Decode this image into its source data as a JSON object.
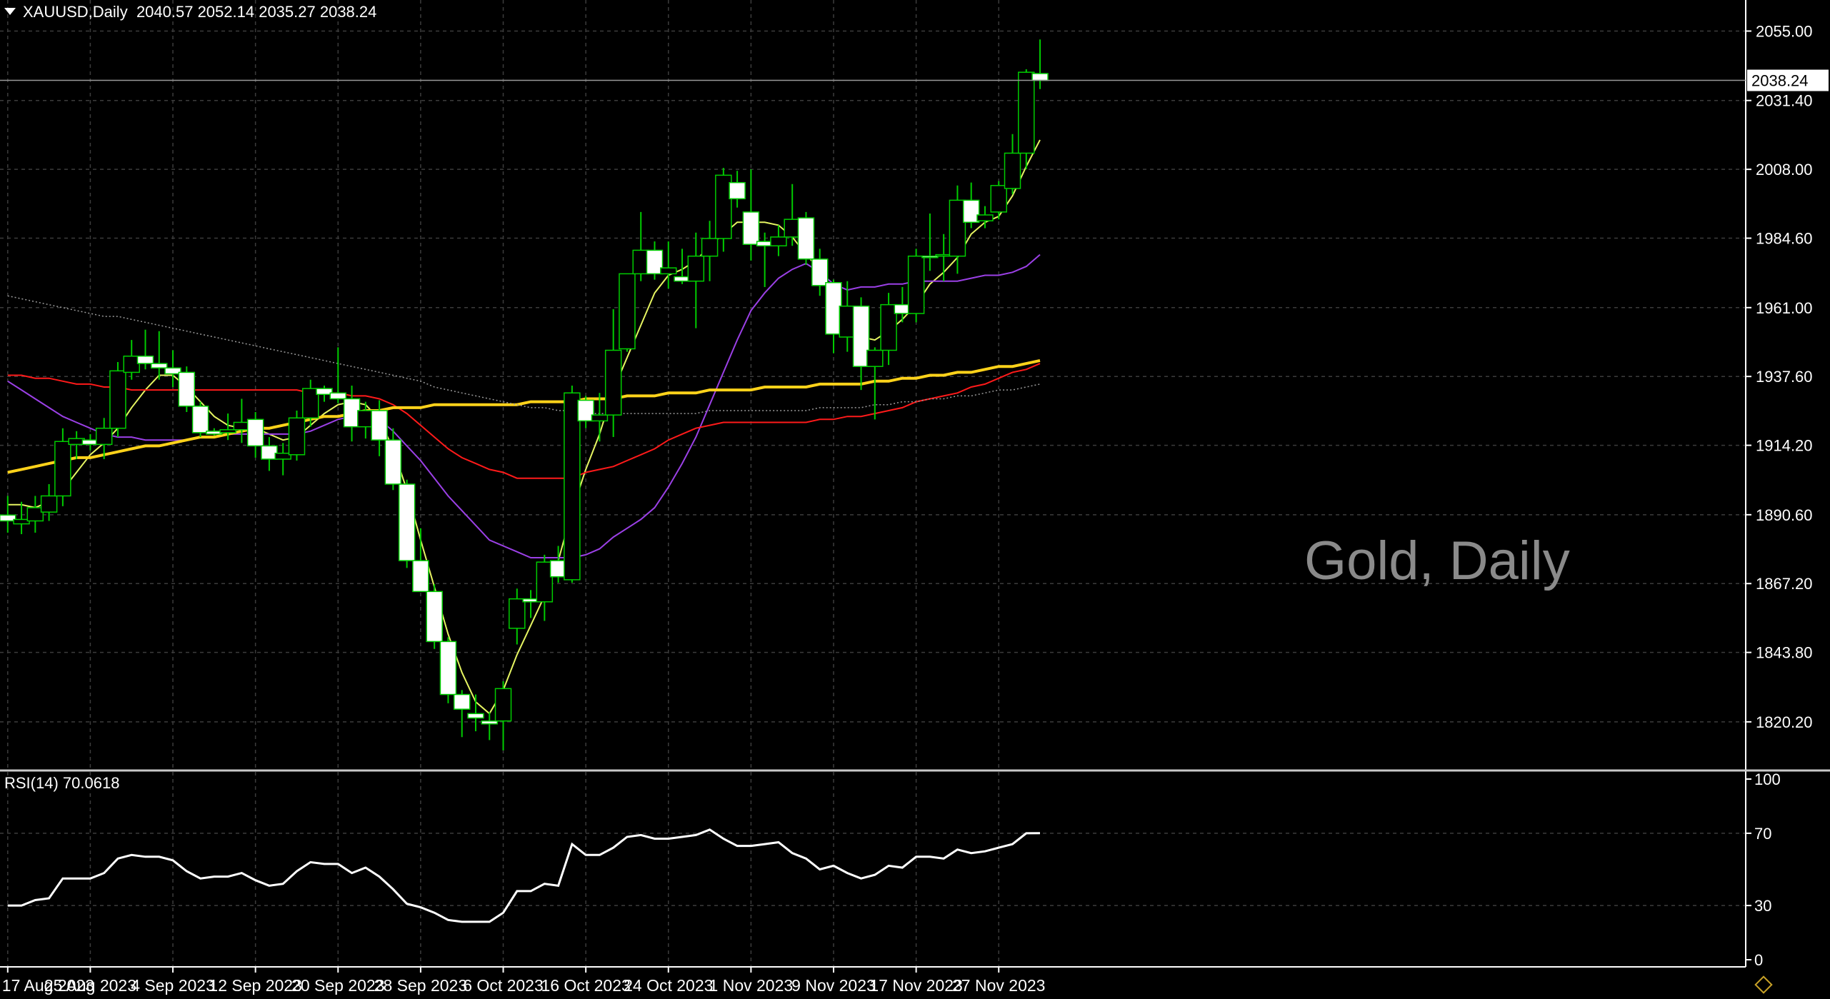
{
  "header": {
    "symbol": "XAUUSD,Daily",
    "ohlc": "2040.57 2052.14 2035.27 2038.24"
  },
  "watermark": "Gold, Daily",
  "rsi_label": "RSI(14) 70.0618",
  "last_price_label": "2038.24",
  "colors": {
    "background": "#000000",
    "grid": "#3c3c3c",
    "bull_candle_outline": "#00cc00",
    "bear_candle_fill": "#ffffff",
    "ma_fast": "#e6f562",
    "ma_mid": "#9b40e6",
    "ma_slow": "#ff1a1a",
    "ma_long": "#ffd21a",
    "ma_200_dotted": "#9a9a9a",
    "rsi_line": "#ffffff"
  },
  "chart_data": [
    {
      "type": "candlestick",
      "title": "XAUUSD,Daily",
      "y_ticks": [
        "2055.00",
        "2031.40",
        "2008.00",
        "1984.60",
        "1961.00",
        "1937.60",
        "1914.20",
        "1890.60",
        "1867.20",
        "1843.80",
        "1820.20"
      ],
      "ylim": [
        1806,
        2065
      ],
      "x_tick_labels": [
        "17 Aug 2023",
        "25 Aug 2023",
        "4 Sep 2023",
        "12 Sep 2023",
        "20 Sep 2023",
        "28 Sep 2023",
        "6 Oct 2023",
        "16 Oct 2023",
        "24 Oct 2023",
        "1 Nov 2023",
        "9 Nov 2023",
        "17 Nov 2023",
        "27 Nov 2023"
      ],
      "x_tick_bar_index": [
        0,
        6,
        12,
        18,
        24,
        30,
        36,
        42,
        48,
        54,
        60,
        66,
        72
      ],
      "last_price": 2038.24,
      "candles": [
        {
          "o": 1890.5,
          "h": 1897.0,
          "l": 1884.5,
          "c": 1888.5
        },
        {
          "o": 1887.5,
          "h": 1895.0,
          "l": 1884.0,
          "c": 1889.0
        },
        {
          "o": 1888.5,
          "h": 1897.0,
          "l": 1884.5,
          "c": 1893.0
        },
        {
          "o": 1891.5,
          "h": 1901.0,
          "l": 1888.5,
          "c": 1897.0
        },
        {
          "o": 1897.0,
          "h": 1920.0,
          "l": 1893.5,
          "c": 1915.5
        },
        {
          "o": 1914.5,
          "h": 1919.0,
          "l": 1909.5,
          "c": 1916.5
        },
        {
          "o": 1916.0,
          "h": 1918.0,
          "l": 1912.5,
          "c": 1914.5
        },
        {
          "o": 1914.5,
          "h": 1923.5,
          "l": 1909.5,
          "c": 1920.0
        },
        {
          "o": 1920.0,
          "h": 1942.5,
          "l": 1917.0,
          "c": 1939.5
        },
        {
          "o": 1939.0,
          "h": 1950.0,
          "l": 1936.5,
          "c": 1944.5
        },
        {
          "o": 1944.5,
          "h": 1953.5,
          "l": 1940.0,
          "c": 1942.0
        },
        {
          "o": 1942.0,
          "h": 1953.0,
          "l": 1936.5,
          "c": 1940.5
        },
        {
          "o": 1940.5,
          "h": 1946.5,
          "l": 1934.0,
          "c": 1938.5
        },
        {
          "o": 1939.0,
          "h": 1941.0,
          "l": 1925.5,
          "c": 1927.5
        },
        {
          "o": 1927.5,
          "h": 1929.0,
          "l": 1917.0,
          "c": 1918.5
        },
        {
          "o": 1919.0,
          "h": 1920.0,
          "l": 1917.5,
          "c": 1918.0
        },
        {
          "o": 1918.5,
          "h": 1925.0,
          "l": 1916.0,
          "c": 1919.5
        },
        {
          "o": 1919.5,
          "h": 1930.0,
          "l": 1915.0,
          "c": 1922.0
        },
        {
          "o": 1923.0,
          "h": 1925.5,
          "l": 1910.0,
          "c": 1914.0
        },
        {
          "o": 1914.0,
          "h": 1917.0,
          "l": 1905.5,
          "c": 1909.5
        },
        {
          "o": 1909.5,
          "h": 1915.0,
          "l": 1904.0,
          "c": 1911.5
        },
        {
          "o": 1911.0,
          "h": 1926.0,
          "l": 1909.0,
          "c": 1923.5
        },
        {
          "o": 1923.5,
          "h": 1936.5,
          "l": 1920.5,
          "c": 1933.5
        },
        {
          "o": 1933.5,
          "h": 1934.5,
          "l": 1929.0,
          "c": 1931.5
        },
        {
          "o": 1932.0,
          "h": 1947.5,
          "l": 1928.5,
          "c": 1930.0
        },
        {
          "o": 1930.0,
          "h": 1934.5,
          "l": 1915.5,
          "c": 1920.5
        },
        {
          "o": 1920.5,
          "h": 1929.0,
          "l": 1916.5,
          "c": 1926.0
        },
        {
          "o": 1926.0,
          "h": 1929.5,
          "l": 1910.5,
          "c": 1916.0
        },
        {
          "o": 1916.0,
          "h": 1920.0,
          "l": 1899.0,
          "c": 1901.0
        },
        {
          "o": 1901.0,
          "h": 1902.5,
          "l": 1872.5,
          "c": 1875.0
        },
        {
          "o": 1875.0,
          "h": 1886.0,
          "l": 1864.5,
          "c": 1864.5
        },
        {
          "o": 1864.5,
          "h": 1867.0,
          "l": 1845.0,
          "c": 1847.5
        },
        {
          "o": 1847.5,
          "h": 1849.0,
          "l": 1826.5,
          "c": 1829.5
        },
        {
          "o": 1829.5,
          "h": 1831.0,
          "l": 1815.0,
          "c": 1824.5
        },
        {
          "o": 1823.0,
          "h": 1829.5,
          "l": 1817.0,
          "c": 1821.5
        },
        {
          "o": 1820.5,
          "h": 1823.5,
          "l": 1814.0,
          "c": 1819.5
        },
        {
          "o": 1820.5,
          "h": 1834.0,
          "l": 1810.5,
          "c": 1831.5
        },
        {
          "o": 1852.0,
          "h": 1865.5,
          "l": 1846.5,
          "c": 1862.0
        },
        {
          "o": 1862.0,
          "h": 1865.0,
          "l": 1855.5,
          "c": 1861.0
        },
        {
          "o": 1861.0,
          "h": 1877.0,
          "l": 1854.5,
          "c": 1874.5
        },
        {
          "o": 1875.0,
          "h": 1880.0,
          "l": 1867.5,
          "c": 1869.5
        },
        {
          "o": 1868.5,
          "h": 1934.5,
          "l": 1867.5,
          "c": 1932.0
        },
        {
          "o": 1929.5,
          "h": 1931.0,
          "l": 1920.0,
          "c": 1922.5
        },
        {
          "o": 1922.5,
          "h": 1932.0,
          "l": 1915.5,
          "c": 1924.5
        },
        {
          "o": 1924.5,
          "h": 1960.5,
          "l": 1917.0,
          "c": 1946.5
        },
        {
          "o": 1947.0,
          "h": 1964.5,
          "l": 1946.0,
          "c": 1972.5
        },
        {
          "o": 1972.5,
          "h": 1993.5,
          "l": 1970.0,
          "c": 1980.5
        },
        {
          "o": 1980.5,
          "h": 1983.5,
          "l": 1970.5,
          "c": 1972.5
        },
        {
          "o": 1972.5,
          "h": 1983.5,
          "l": 1967.5,
          "c": 1974.5
        },
        {
          "o": 1971.5,
          "h": 1981.0,
          "l": 1969.0,
          "c": 1970.0
        },
        {
          "o": 1970.0,
          "h": 1986.5,
          "l": 1954.0,
          "c": 1978.5
        },
        {
          "o": 1978.5,
          "h": 1990.5,
          "l": 1970.0,
          "c": 1984.5
        },
        {
          "o": 1984.5,
          "h": 2008.5,
          "l": 1980.0,
          "c": 2006.0
        },
        {
          "o": 2003.5,
          "h": 2007.5,
          "l": 1995.0,
          "c": 1998.0
        },
        {
          "o": 1993.5,
          "h": 2008.0,
          "l": 1977.0,
          "c": 1982.5
        },
        {
          "o": 1983.5,
          "h": 1986.5,
          "l": 1968.0,
          "c": 1982.0
        },
        {
          "o": 1982.0,
          "h": 1989.0,
          "l": 1978.5,
          "c": 1985.0
        },
        {
          "o": 1985.0,
          "h": 2003.0,
          "l": 1982.0,
          "c": 1991.0
        },
        {
          "o": 1991.5,
          "h": 1993.5,
          "l": 1975.5,
          "c": 1977.5
        },
        {
          "o": 1977.5,
          "h": 1981.0,
          "l": 1965.0,
          "c": 1968.5
        },
        {
          "o": 1969.5,
          "h": 1970.5,
          "l": 1945.5,
          "c": 1952.0
        },
        {
          "o": 1951.0,
          "h": 1970.0,
          "l": 1946.0,
          "c": 1961.5
        },
        {
          "o": 1961.5,
          "h": 1964.5,
          "l": 1933.0,
          "c": 1941.0
        },
        {
          "o": 1941.0,
          "h": 1947.5,
          "l": 1923.0,
          "c": 1946.5
        },
        {
          "o": 1946.5,
          "h": 1966.0,
          "l": 1941.5,
          "c": 1962.0
        },
        {
          "o": 1962.0,
          "h": 1968.0,
          "l": 1956.0,
          "c": 1959.0
        },
        {
          "o": 1959.0,
          "h": 1981.0,
          "l": 1956.0,
          "c": 1978.5
        },
        {
          "o": 1978.5,
          "h": 1993.0,
          "l": 1973.5,
          "c": 1978.0
        },
        {
          "o": 1978.5,
          "h": 1986.0,
          "l": 1970.0,
          "c": 1979.0
        },
        {
          "o": 1978.5,
          "h": 2002.5,
          "l": 1972.5,
          "c": 1997.5
        },
        {
          "o": 1997.5,
          "h": 2003.5,
          "l": 1988.0,
          "c": 1990.0
        },
        {
          "o": 1990.5,
          "h": 1995.5,
          "l": 1988.0,
          "c": 1992.5
        },
        {
          "o": 1993.5,
          "h": 2004.0,
          "l": 1991.0,
          "c": 2002.5
        },
        {
          "o": 2001.5,
          "h": 2020.0,
          "l": 1999.5,
          "c": 2013.5
        },
        {
          "o": 2013.5,
          "h": 2042.0,
          "l": 2008.0,
          "c": 2041.0
        },
        {
          "o": 2040.57,
          "h": 2052.14,
          "l": 2035.27,
          "c": 2038.24
        }
      ],
      "series": [
        {
          "name": "MA fast",
          "color": "#e6f562",
          "style": "solid",
          "values": [
            1894,
            1894,
            1893,
            1895,
            1899,
            1905,
            1911,
            1915,
            1920,
            1927,
            1933,
            1938,
            1938,
            1934,
            1929,
            1924,
            1921,
            1920,
            1920,
            1918,
            1916,
            1917,
            1921,
            1925,
            1928,
            1929,
            1928,
            1923,
            1913,
            1899,
            1882,
            1866,
            1850,
            1837,
            1827,
            1823,
            1831,
            1843,
            1853,
            1863,
            1875,
            1892,
            1906,
            1918,
            1933,
            1944,
            1955,
            1966,
            1972,
            1974,
            1977,
            1982,
            1986,
            1990,
            1990,
            1990,
            1989,
            1985,
            1979,
            1974,
            1966,
            1957,
            1951,
            1950,
            1953,
            1957,
            1962,
            1969,
            1973,
            1978,
            1986,
            1990,
            1992,
            1999,
            2009,
            2018
          ]
        },
        {
          "name": "MA mid",
          "color": "#9b40e6",
          "style": "solid",
          "values": [
            1936,
            1933,
            1930,
            1927,
            1924,
            1922,
            1920,
            1918,
            1917,
            1917,
            1916,
            1916,
            1916,
            1916,
            1917,
            1917,
            1918,
            1918,
            1918,
            1918,
            1918,
            1918,
            1919,
            1921,
            1923,
            1924,
            1925,
            1923,
            1919,
            1914,
            1909,
            1903,
            1897,
            1892,
            1887,
            1882,
            1880,
            1878,
            1876,
            1876,
            1876,
            1876,
            1877,
            1879,
            1883,
            1886,
            1889,
            1893,
            1900,
            1908,
            1917,
            1928,
            1939,
            1950,
            1960,
            1966,
            1971,
            1974,
            1976,
            1973,
            1969,
            1967,
            1968,
            1968,
            1969,
            1969,
            1970,
            1970,
            1970,
            1970,
            1971,
            1972,
            1972,
            1973,
            1975,
            1979
          ]
        },
        {
          "name": "MA slow",
          "color": "#ff1a1a",
          "style": "solid",
          "values": [
            1938,
            1938,
            1937,
            1937,
            1936,
            1935,
            1935,
            1934,
            1934,
            1933,
            1933,
            1933,
            1933,
            1933,
            1933,
            1933,
            1933,
            1933,
            1933,
            1933,
            1933,
            1933,
            1932,
            1932,
            1932,
            1931,
            1931,
            1930,
            1928,
            1925,
            1921,
            1917,
            1913,
            1910,
            1908,
            1906,
            1905,
            1903,
            1903,
            1903,
            1903,
            1903,
            1905,
            1906,
            1907,
            1909,
            1911,
            1913,
            1916,
            1918,
            1920,
            1921,
            1922,
            1922,
            1922,
            1922,
            1922,
            1922,
            1922,
            1923,
            1923,
            1924,
            1924,
            1925,
            1926,
            1927,
            1929,
            1930,
            1931,
            1932,
            1934,
            1935,
            1937,
            1939,
            1940,
            1942
          ]
        },
        {
          "name": "MA long",
          "color": "#ffd21a",
          "style": "thick",
          "values": [
            1905,
            1906,
            1907,
            1908,
            1909,
            1910,
            1910,
            1911,
            1912,
            1913,
            1914,
            1914,
            1915,
            1916,
            1917,
            1917,
            1918,
            1919,
            1920,
            1920,
            1921,
            1922,
            1923,
            1924,
            1924,
            1925,
            1926,
            1926,
            1927,
            1927,
            1927,
            1928,
            1928,
            1928,
            1928,
            1928,
            1928,
            1928,
            1929,
            1929,
            1929,
            1929,
            1930,
            1930,
            1930,
            1931,
            1931,
            1931,
            1932,
            1932,
            1932,
            1933,
            1933,
            1933,
            1933,
            1934,
            1934,
            1934,
            1934,
            1935,
            1935,
            1935,
            1935,
            1936,
            1936,
            1937,
            1937,
            1938,
            1938,
            1939,
            1939,
            1940,
            1941,
            1941,
            1942,
            1943
          ]
        },
        {
          "name": "MA 200",
          "color": "#9a9a9a",
          "style": "dotted",
          "values": [
            1965,
            1964,
            1963,
            1962,
            1961,
            1960,
            1959,
            1958,
            1958,
            1957,
            1956,
            1955,
            1954,
            1953,
            1952,
            1951,
            1950,
            1949,
            1948,
            1947,
            1946,
            1945,
            1944,
            1943,
            1942,
            1941,
            1940,
            1939,
            1938,
            1937,
            1936,
            1934,
            1933,
            1932,
            1931,
            1930,
            1929,
            1928,
            1927,
            1927,
            1926,
            1926,
            1925,
            1925,
            1925,
            1925,
            1925,
            1925,
            1925,
            1925,
            1925,
            1926,
            1926,
            1926,
            1926,
            1926,
            1926,
            1926,
            1926,
            1927,
            1927,
            1927,
            1927,
            1928,
            1928,
            1929,
            1929,
            1930,
            1930,
            1931,
            1931,
            1932,
            1933,
            1933,
            1934,
            1935
          ]
        }
      ]
    },
    {
      "type": "line",
      "title": "RSI(14) 70.0618",
      "ylim": [
        0,
        100
      ],
      "y_ticks": [
        100,
        70,
        30,
        0
      ],
      "series": [
        {
          "name": "RSI(14)",
          "color": "#ffffff",
          "values": [
            30,
            30,
            33,
            34,
            45,
            45,
            45,
            48,
            56,
            58,
            57,
            57,
            55,
            49,
            45,
            46,
            46,
            48,
            44,
            41,
            42,
            49,
            54,
            53,
            53,
            48,
            51,
            46,
            39,
            31,
            29,
            26,
            22,
            21,
            21,
            21,
            26,
            38,
            38,
            42,
            41,
            64,
            58,
            58,
            62,
            68,
            69,
            67,
            67,
            68,
            69,
            72,
            67,
            63,
            63,
            64,
            65,
            59,
            56,
            50,
            52,
            48,
            45,
            47,
            52,
            51,
            57,
            57,
            56,
            61,
            59,
            60,
            62,
            64,
            70,
            70.0618
          ]
        }
      ]
    }
  ]
}
